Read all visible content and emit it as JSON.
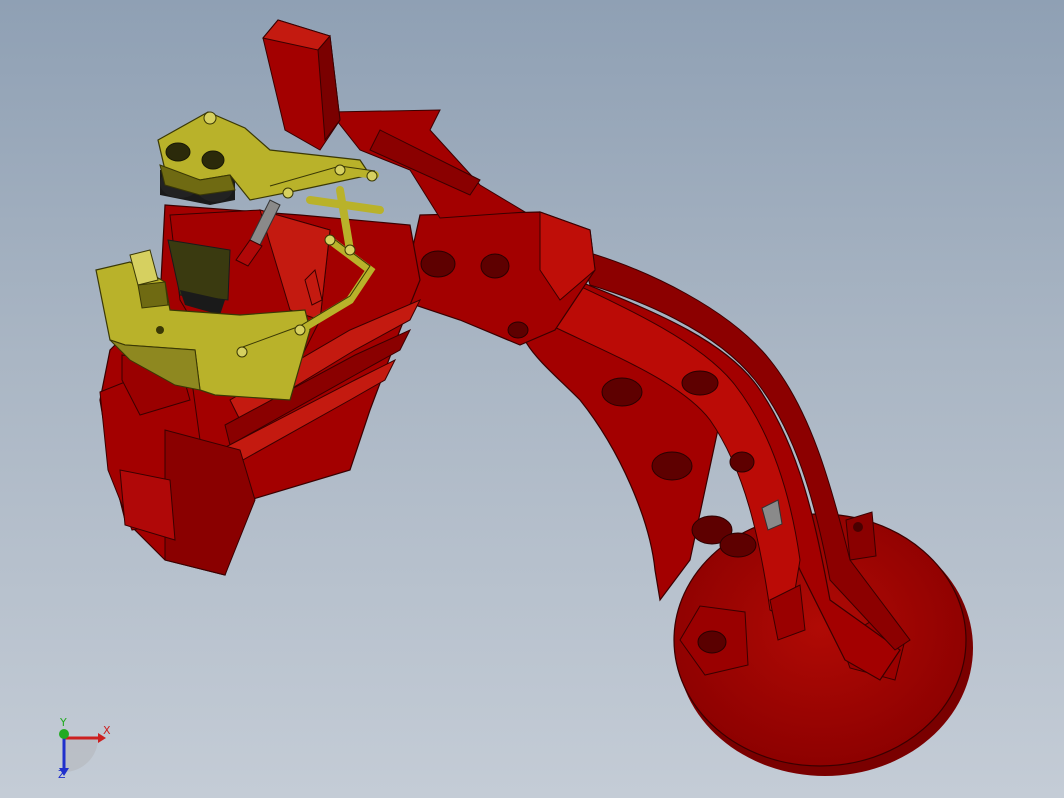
{
  "scene": {
    "model": "robot-arm-assembly",
    "colors": {
      "body_red": "#a30000",
      "body_red_dark": "#7a0000",
      "body_red_light": "#c41a10",
      "gripper_olive": "#b9b22a",
      "gripper_olive_dark": "#6f6a12",
      "shadow_black": "#1a1a1a",
      "rod_grey": "#8a8a8a"
    }
  },
  "triad": {
    "x_label": "X",
    "y_label": "Y",
    "z_label": "Z",
    "colors": {
      "x": "#cc2020",
      "y": "#22aa22",
      "z": "#2030cc"
    }
  }
}
